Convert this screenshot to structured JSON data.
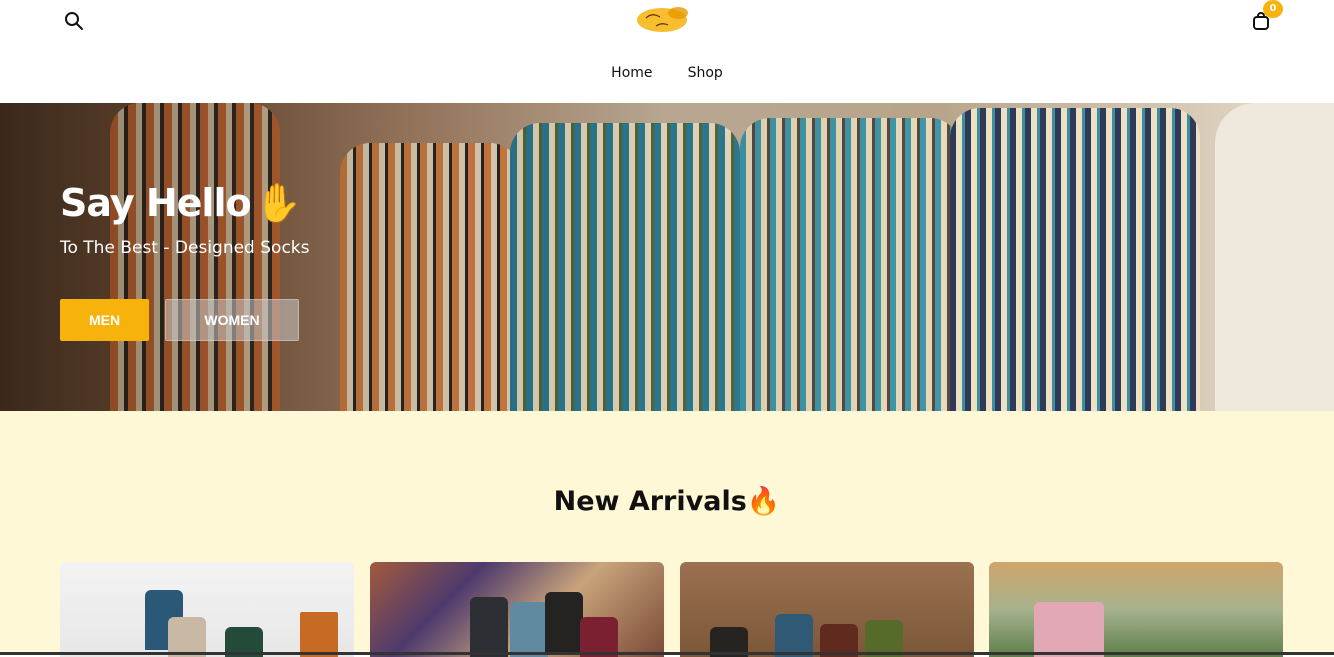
{
  "header": {
    "search_icon": "search-icon",
    "logo_alt": "Fashion Squad logo",
    "cart_icon": "shopping-bag-icon",
    "cart_count": "0",
    "nav": [
      "Home",
      "Shop"
    ]
  },
  "hero": {
    "title": "Say Hello",
    "title_emoji": "✋",
    "subtitle": "To The Best - Designed Socks",
    "buttons": {
      "men": "MEN",
      "women": "WOMEN"
    }
  },
  "arrivals": {
    "title": "New Arrivals",
    "title_emoji": "🔥"
  },
  "colors": {
    "accent": "#f7b30c",
    "section_bg": "#fff8d6"
  }
}
